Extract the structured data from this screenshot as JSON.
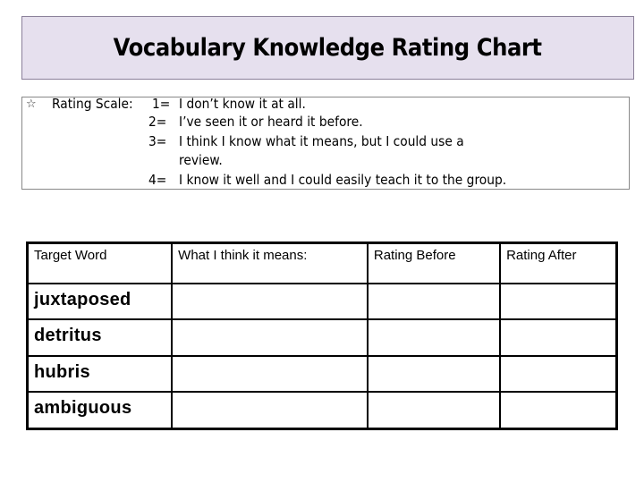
{
  "title": "Vocabulary Knowledge Rating Chart",
  "rating_scale": {
    "bullet_icon": "star-outline-icon",
    "label": "Rating Scale:",
    "levels": [
      {
        "num": "1=",
        "text": "I don’t know it at all."
      },
      {
        "num": "2=",
        "text": "I’ve seen it or heard it before."
      },
      {
        "num": "3=",
        "text": "I think I know what it means, but I could use a",
        "text_cont": "review."
      },
      {
        "num": "4=",
        "text": "I know it well and I could easily teach it to the group."
      }
    ]
  },
  "table": {
    "headers": [
      "Target Word",
      "What I think it means:",
      "Rating Before",
      "Rating After"
    ],
    "rows": [
      {
        "word": "juxtaposed",
        "meaning": "",
        "before": "",
        "after": ""
      },
      {
        "word": "detritus",
        "meaning": "",
        "before": "",
        "after": ""
      },
      {
        "word": "hubris",
        "meaning": "",
        "before": "",
        "after": ""
      },
      {
        "word": "ambiguous",
        "meaning": "",
        "before": "",
        "after": ""
      }
    ]
  },
  "colors": {
    "title_bg": "#e6e0ee",
    "title_border": "#8a7f99"
  }
}
